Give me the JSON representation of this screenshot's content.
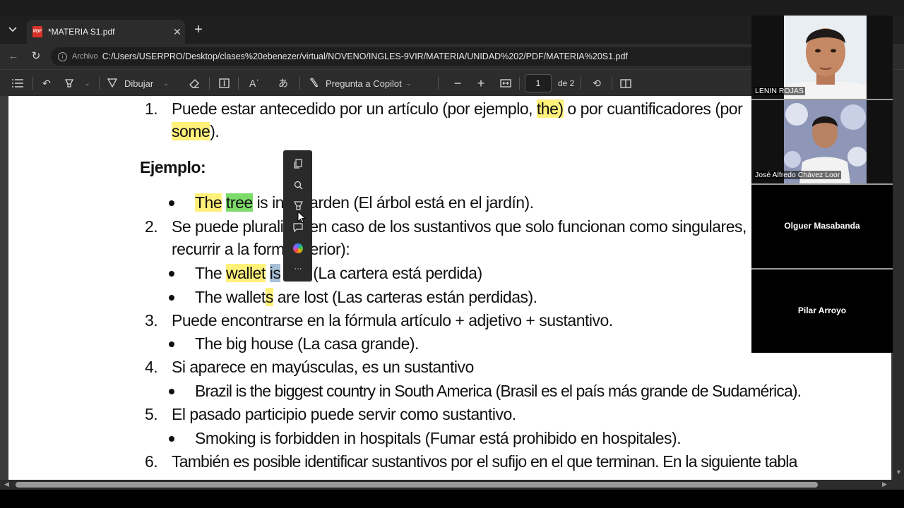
{
  "browser": {
    "tab_title": "*MATERIA S1.pdf",
    "pdf_icon_label": "PDF",
    "url_scheme": "Archivo",
    "url": "C:/Users/USERPRO/Desktop/clases%20ebenezer/virtual/NOVENO/INGLES-9VIR/MATERIA/UNIDAD%202/PDF/MATERIA%20S1.pdf"
  },
  "pdf_toolbar": {
    "draw_label": "Dibujar",
    "copilot_label": "Pregunta a Copilot",
    "page_current": "1",
    "page_total": "de 2",
    "read_aloud_glyph": "Aʾ",
    "translate_glyph": "あ"
  },
  "document": {
    "item1_num": "1.",
    "item1_pre": "Puede estar antecedido por un artículo (por ejemplo, ",
    "item1_the": "the)",
    "item1_post": " o  por cuantificadores (por",
    "item1_some": "some",
    "item1_end": ").",
    "example_heading": "Ejemplo:",
    "ex1_the": "The",
    "ex1_tree": "tree",
    "ex1_is_in": "is in",
    "ex1_rest": "garden (El árbol está en el jardín).",
    "item2_num": "2.",
    "item2_pre": "Se puede plurali",
    "item2_post": "(en caso de los sustantivos que solo funcionan como singulares,",
    "item2_line2_pre": "recurrir a la form",
    "item2_line2_post": "terior):",
    "ex2_the": "The",
    "ex2_wallet": "wallet",
    "ex2_is": "is",
    "ex2_rest": "(La cartera está perdida)",
    "ex3_pre": "The wallet",
    "ex3_s": "s",
    "ex3_rest": " are lost (Las carteras están perdidas).",
    "item3_num": "3.",
    "item3_text": "Puede encontrarse en la fórmula artículo + adjetivo + sustantivo.",
    "ex4_text": "The big house (La casa grande).",
    "item4_num": "4.",
    "item4_text": "Si aparece en mayúsculas, es un sustantivo",
    "ex5_text": "Brazil is the biggest country in South America (Brasil es el país más grande de Sudamérica).",
    "item5_num": "5.",
    "item5_text": "El pasado participio puede servir como sustantivo.",
    "ex6_text": "Smoking is forbidden in hospitals (Fumar está prohibido en hospitales).",
    "item6_num": "6.",
    "item6_text": "También es posible identificar sustantivos por el sufijo en el que terminan. En la siguiente tabla"
  },
  "mini_toolbar": {
    "more_glyph": "···"
  },
  "call": {
    "participants": [
      {
        "name": "LENIN ROJAS"
      },
      {
        "name": "José Alfredo Chávez Loor"
      },
      {
        "name": "Olguer Masabanda"
      },
      {
        "name": "Pilar Arroyo"
      }
    ]
  },
  "colors": {
    "highlight_yellow": "#fff17a",
    "highlight_green": "#7ddb6a",
    "highlight_blue": "#a6c0d6"
  },
  "icons": [
    "chevron-down-icon",
    "close-icon",
    "plus-icon",
    "back-icon",
    "refresh-icon",
    "info-icon",
    "list-icon",
    "undo-icon",
    "highlighter-icon",
    "draw-icon",
    "eraser-icon",
    "textbox-icon",
    "read-aloud-icon",
    "translate-icon",
    "copilot-icon",
    "zoom-out-icon",
    "zoom-in-icon",
    "fit-page-icon",
    "rotate-icon",
    "two-page-icon",
    "copy-icon",
    "search-icon",
    "comment-icon",
    "more-icon"
  ]
}
